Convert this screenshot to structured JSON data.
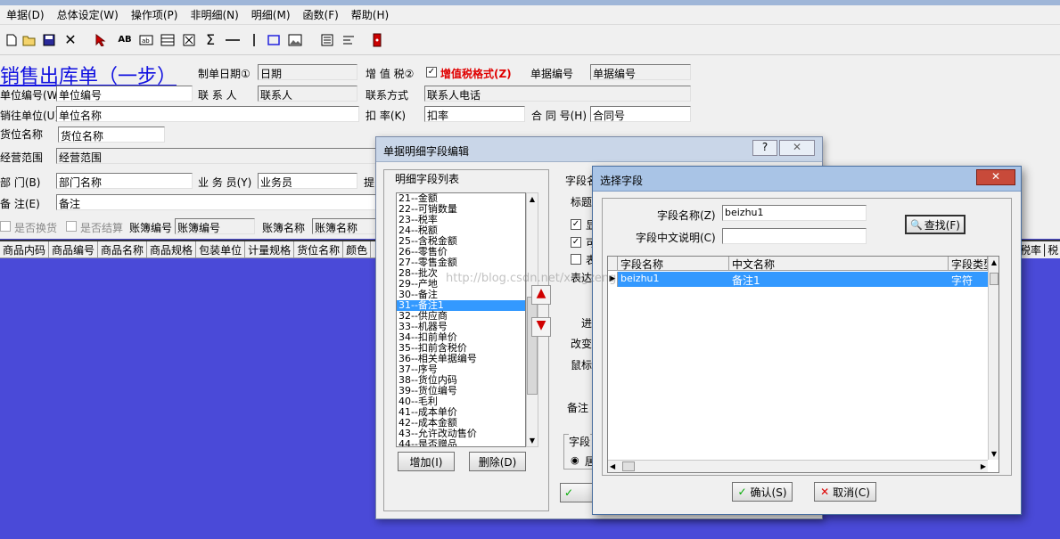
{
  "menu": [
    "单据(D)",
    "总体设定(W)",
    "操作项(P)",
    "非明细(N)",
    "明细(M)",
    "函数(F)",
    "帮助(H)"
  ],
  "toolbar": {
    "icons": [
      "new-doc-icon",
      "open-folder-icon",
      "save-icon",
      "delete-x-icon",
      "pointer-icon",
      "text-ab-icon",
      "label-icon",
      "table-icon",
      "field-icon",
      "sum-icon",
      "hline-icon",
      "vline-icon",
      "rect-icon",
      "image-icon",
      "report-icon",
      "list-icon",
      "exit-icon"
    ]
  },
  "form": {
    "title": "销售出库单（一步）",
    "rows": {
      "date_label": "制单日期①",
      "date_value": "日期",
      "vat_label": "增 值 税②",
      "vat_format": "增值税格式(Z)",
      "docno_label": "单据编号",
      "docno_value": "单据编号",
      "unitcode_label": "单位编号(W)",
      "unitcode_value": "单位编号",
      "contact_label": "联 系 人",
      "contact_value": "联系人",
      "contactway_label": "联系方式",
      "contactway_value": "联系人电话",
      "saleunit_label": "销往单位(U)",
      "saleunit_value": "单位名称",
      "discount_label": "扣 率(K)",
      "discount_value": "扣率",
      "contract_label": "合 同 号(H)",
      "contract_value": "合同号",
      "location_label": "货位名称",
      "location_value": "货位名称",
      "scope_label": "经营范围",
      "scope_value": "经营范围",
      "dept_label": "部 门(B)",
      "dept_value": "部门名称",
      "salesman_label": "业 务 员(Y)",
      "salesman_value": "业务员",
      "tip_label": "提",
      "remark_label": "备 注(E)",
      "remark_value": "备注",
      "exchange_label": "是否换货",
      "settle_label": "是否结算",
      "book_label": "账簿编号",
      "book_value": "账簿编号",
      "bookname_label": "账簿名称",
      "bookname_value": "账簿名称"
    }
  },
  "grid": {
    "headers": [
      "商品内码",
      "商品编号",
      "商品名称",
      "商品规格",
      "包装单位",
      "计量规格",
      "货位名称",
      "颜色"
    ],
    "right_headers": [
      "税率",
      "税"
    ]
  },
  "dialog1": {
    "title": "单据明细字段编辑",
    "list_title": "明细字段列表",
    "items": [
      "21--金额",
      "22--可销数量",
      "23--税率",
      "24--税额",
      "25--含税金额",
      "26--零售价",
      "27--零售金额",
      "28--批次",
      "29--产地",
      "30--备注",
      "31--备注1",
      "32--供应商",
      "33--机器号",
      "34--扣前单价",
      "35--扣前含税价",
      "36--相关单据编号",
      "37--序号",
      "38--货位内码",
      "39--货位编号",
      "40--毛利",
      "41--成本单价",
      "42--成本金额",
      "43--允许改动售价",
      "44--是否赠品"
    ],
    "selected_index": 10,
    "add_btn": "增加(I)",
    "del_btn": "删除(D)",
    "right_labels": [
      "字段名",
      "标题",
      "显",
      "可",
      "表",
      "表达",
      "进",
      "改变",
      "鼠标",
      "备注",
      "字段"
    ],
    "radio_label": "居"
  },
  "dialog2": {
    "title": "选择字段",
    "field_name_label": "字段名称(Z)",
    "field_name_value": "beizhu1",
    "field_cn_label": "字段中文说明(C)",
    "field_cn_value": "",
    "find_btn": "查找(F)",
    "columns": [
      "字段名称",
      "中文名称",
      "字段类型"
    ],
    "rows": [
      [
        "beizhu1",
        "备注1",
        "字符"
      ]
    ],
    "ok_btn": "确认(S)",
    "cancel_btn": "取消(C)",
    "watermark": "http://blog.csdn.net/xingzeng"
  }
}
